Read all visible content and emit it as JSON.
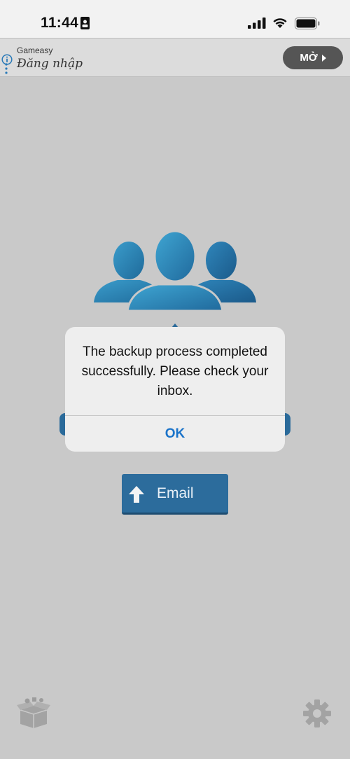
{
  "status_bar": {
    "time": "11:44"
  },
  "ad": {
    "brand": "Gameasy",
    "tagline": "Đăng nhập",
    "open_label": "MỞ"
  },
  "alert": {
    "message": "The backup process completed successfully. Please check your inbox.",
    "ok_label": "OK"
  },
  "email_button": {
    "label": "Email"
  },
  "colors": {
    "background": "#c9c9c9",
    "accent_blue": "#2c6c9c",
    "link_blue": "#1a73c9"
  }
}
